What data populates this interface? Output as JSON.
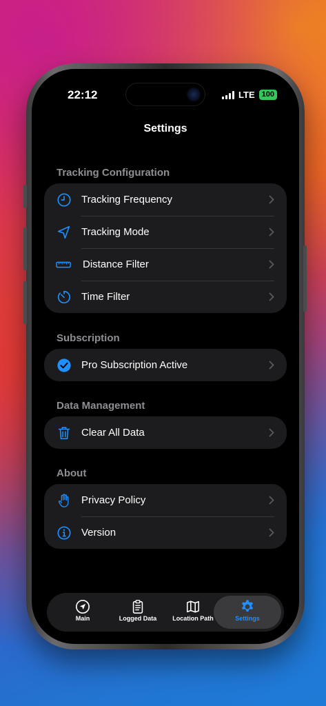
{
  "status": {
    "time": "22:12",
    "network": "LTE",
    "battery": "100"
  },
  "header": {
    "title": "Settings"
  },
  "sections": {
    "tracking": {
      "header": "Tracking Configuration",
      "items": [
        {
          "label": "Tracking Frequency",
          "icon": "clock-icon"
        },
        {
          "label": "Tracking Mode",
          "icon": "location-arrow-icon"
        },
        {
          "label": "Distance Filter",
          "icon": "ruler-icon"
        },
        {
          "label": "Time Filter",
          "icon": "timer-icon"
        }
      ]
    },
    "subscription": {
      "header": "Subscription",
      "items": [
        {
          "label": "Pro Subscription Active",
          "icon": "checkmark-circle-icon"
        }
      ]
    },
    "data": {
      "header": "Data Management",
      "items": [
        {
          "label": "Clear All Data",
          "icon": "trash-icon"
        }
      ]
    },
    "about": {
      "header": "About",
      "items": [
        {
          "label": "Privacy Policy",
          "icon": "hand-raised-icon"
        },
        {
          "label": "Version",
          "icon": "info-circle-icon"
        }
      ]
    }
  },
  "tabbar": {
    "items": [
      {
        "label": "Main",
        "icon": "location-arrow-circle-icon"
      },
      {
        "label": "Logged Data",
        "icon": "clipboard-icon"
      },
      {
        "label": "Location Path",
        "icon": "map-icon"
      },
      {
        "label": "Settings",
        "icon": "gear-icon"
      }
    ],
    "active": "Settings"
  },
  "colors": {
    "accent": "#1e90ff",
    "background": "#000000",
    "card": "#1c1c1e",
    "section_header": "#8e8e93",
    "battery": "#34c759"
  }
}
